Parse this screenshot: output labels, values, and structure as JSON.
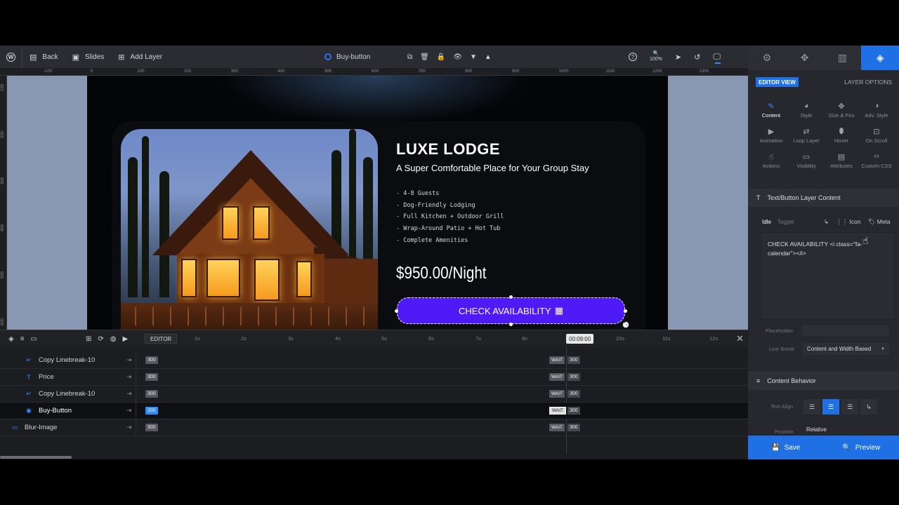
{
  "toolbar": {
    "back_label": "Back",
    "slides_label": "Slides",
    "add_layer_label": "Add Layer",
    "selected_layer": "Buy-button",
    "zoom_level": "100%"
  },
  "ruler": {
    "top_ticks": [
      "-100",
      "0",
      "100",
      "200",
      "300",
      "400",
      "500",
      "600",
      "700",
      "800",
      "900",
      "1000",
      "1100",
      "1200",
      "1300"
    ],
    "left_ticks": [
      "100",
      "200",
      "300",
      "400",
      "500",
      "600"
    ]
  },
  "slide": {
    "title": "LUXE LODGE",
    "subtitle": "A Super Comfortable Place for Your Group Stay",
    "features": [
      "- 4-8 Guests",
      "- Dog-Friendly Lodging",
      "- Full Kitchen + Outdoor Grill",
      "- Wrap-Around Patio + Hot Tub",
      "- Complete Amenities"
    ],
    "price": "$950.00/Night",
    "button_label": "CHECK AVAILABILITY",
    "button_icon": "calendar-icon"
  },
  "timeline": {
    "editor_label": "EDITOR",
    "seconds": [
      "1s",
      "2s",
      "3s",
      "4s",
      "5s",
      "6s",
      "7s",
      "8s",
      "9s",
      "10s",
      "11s",
      "12s"
    ],
    "current_time": "00:09:00",
    "rows": [
      {
        "name": "Copy Linebreak-10",
        "icon": "linebreak-icon",
        "value": "300",
        "wait": "WAIT",
        "value2": "300"
      },
      {
        "name": "Price",
        "icon": "text-icon",
        "value": "300",
        "wait": "WAIT",
        "value2": "300"
      },
      {
        "name": "Copy Linebreak-10",
        "icon": "linebreak-icon",
        "value": "300",
        "wait": "WAIT",
        "value2": "300"
      },
      {
        "name": "Buy-Button",
        "icon": "button-icon",
        "value": "300",
        "wait": "WAIT",
        "value2": "300"
      },
      {
        "name": "Blur-Image",
        "icon": "image-icon",
        "value": "300",
        "wait": "WAIT",
        "value2": "300"
      }
    ]
  },
  "panel": {
    "editor_view": "EDITOR VIEW",
    "layer_options": "LAYER OPTIONS",
    "options": [
      "Content",
      "Style",
      "Size & Pos",
      "Adv. Style",
      "Animation",
      "Loop Layer",
      "Hover",
      "On Scroll",
      "Actions",
      "Visibility",
      "Attributes",
      "Custom CSS"
    ],
    "section_content": "Text/Button Layer Content",
    "state_idle": "Idle",
    "state_toggle": "Toggle",
    "icon_label": "Icon",
    "meta_label": "Meta",
    "content_text": "CHECK AVAILABILITY <i class=\"fa-calendar\"></i>",
    "placeholder_label": "Placeholder",
    "linebreak_label": "Line Break",
    "linebreak_value": "Content and Width Based",
    "section_behavior": "Content Behavior",
    "text_align_label": "Text Align",
    "position_label": "Position",
    "position_value": "Relative",
    "save_label": "Save",
    "preview_label": "Preview"
  },
  "colors": {
    "accent": "#1f6fe5",
    "button": "#4e1bf7"
  }
}
